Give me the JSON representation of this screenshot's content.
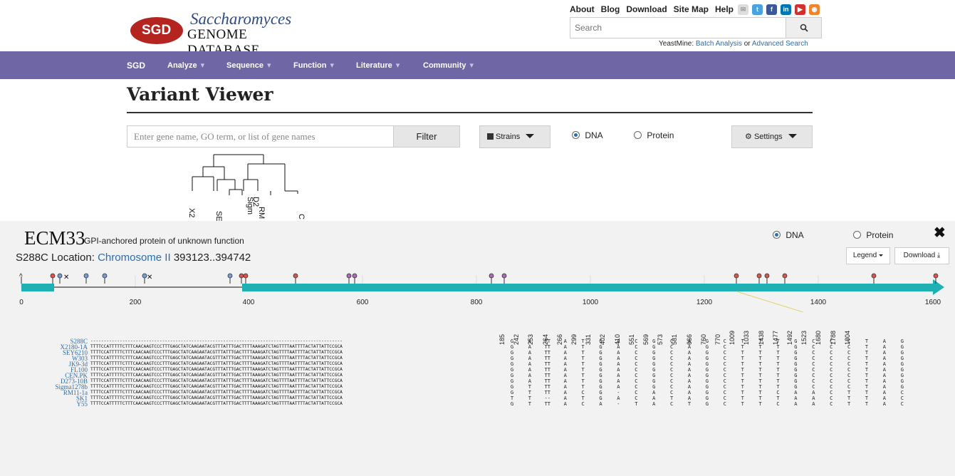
{
  "header": {
    "logo": {
      "badge": "SGD",
      "line1": "Saccharomyces",
      "line2": "GENOME DATABASE"
    },
    "top_links": [
      "About",
      "Blog",
      "Download",
      "Site Map",
      "Help"
    ],
    "social_icons": [
      "mail-icon",
      "twitter-icon",
      "facebook-icon",
      "linkedin-icon",
      "youtube-icon",
      "rss-icon"
    ],
    "search": {
      "placeholder": "Search"
    },
    "yeastmine": {
      "prefix": "YeastMine:",
      "batch": "Batch Analysis",
      "or": "or",
      "advanced": "Advanced Search"
    }
  },
  "nav": {
    "items": [
      "SGD",
      "Analyze",
      "Sequence",
      "Function",
      "Literature",
      "Community"
    ]
  },
  "page": {
    "title": "Variant Viewer"
  },
  "filter": {
    "placeholder": "Enter gene name, GO term, or list of gene names",
    "button": "Filter",
    "strains": "Strains",
    "dna": "DNA",
    "protein": "Protein",
    "settings": "Settings"
  },
  "tree_labels": [
    "X2",
    "SE",
    "Sigm",
    "D2",
    "RM",
    "C"
  ],
  "panel": {
    "gene": "ECM33",
    "description": "GPI-anchored protein of unknown function",
    "location_prefix": "S288C Location:",
    "chromosome": "Chromosome II",
    "coords": "393123..394742",
    "dna": "DNA",
    "protein": "Protein",
    "legend": "Legend",
    "download": "Download",
    "axis_ticks": [
      "0",
      "200",
      "400",
      "600",
      "800",
      "1000",
      "1200",
      "1400",
      "1600"
    ]
  },
  "colors": {
    "nav": "#6f66a5",
    "logo": "#b5251f",
    "link": "#2a6db0",
    "track": "#1fb0b4",
    "pin_red": "#d9534f",
    "pin_blue": "#6fa0d8",
    "pin_purple": "#a66bb0"
  },
  "alignment": {
    "strains": [
      "S288C",
      "X2180-1A",
      "SEY6210",
      "W303",
      "JK9-3d",
      "FL100",
      "CEN.PK",
      "D273-10B",
      "Sigma1278b",
      "RM11-1a",
      "SK1",
      "Y55"
    ],
    "sequence": "TTTTCCATTTTTCTTTCAACAAGTCCCTTTGAGCTATCAAGAATACGTTTATTTGACTTTTAAAGATCTAGTTTTAATTTTACTATTATTCCGCA",
    "positions": [
      "185",
      "242",
      "253",
      "264",
      "266",
      "299",
      "331",
      "402",
      "410",
      "551",
      "569",
      "573",
      "581",
      "666",
      "760",
      "770",
      "1009",
      "1033",
      "1438",
      "1477",
      "1492",
      "1523",
      "1680",
      "1788",
      "1804"
    ],
    "columns": [
      [
        "G",
        "G",
        "G",
        "G",
        "G",
        "G",
        "G",
        "G",
        "G",
        "G",
        "T",
        "G"
      ],
      [
        "A",
        "A",
        "A",
        "A",
        "A",
        "A",
        "A",
        "A",
        "T",
        "T",
        "T",
        "T"
      ],
      [
        "TT",
        "TT",
        "TT",
        "TT",
        "TT",
        "TT",
        "TT",
        "TT",
        "TT",
        "TT",
        "--",
        "TT"
      ],
      [
        "A",
        "A",
        "A",
        "A",
        "A",
        "A",
        "A",
        "A",
        "A",
        "A",
        "A",
        "A"
      ],
      [
        "T",
        "T",
        "T",
        "T",
        "T",
        "T",
        "T",
        "T",
        "T",
        "C",
        "T",
        "C"
      ],
      [
        "G",
        "G",
        "G",
        "G",
        "G",
        "G",
        "G",
        "G",
        "G",
        "G",
        "G",
        "A"
      ],
      [
        "A",
        "A",
        "A",
        "A",
        "A",
        "A",
        "A",
        "A",
        "A",
        "-",
        "A",
        "-"
      ],
      [
        "C",
        "C",
        "C",
        "C",
        "C",
        "C",
        "C",
        "C",
        "C",
        "C",
        "C",
        "T"
      ],
      [
        "G",
        "G",
        "G",
        "G",
        "G",
        "G",
        "G",
        "G",
        "G",
        "A",
        "A",
        "A"
      ],
      [
        "C",
        "C",
        "C",
        "C",
        "C",
        "C",
        "C",
        "C",
        "C",
        "C",
        "T",
        "C"
      ],
      [
        "A",
        "A",
        "A",
        "A",
        "A",
        "A",
        "A",
        "A",
        "A",
        "A",
        "A",
        "T"
      ],
      [
        "G",
        "G",
        "G",
        "G",
        "G",
        "G",
        "G",
        "G",
        "G",
        "G",
        "G",
        "G"
      ],
      [
        "C",
        "C",
        "C",
        "C",
        "C",
        "C",
        "C",
        "C",
        "C",
        "C",
        "C",
        "C"
      ],
      [
        "T",
        "T",
        "T",
        "T",
        "T",
        "T",
        "T",
        "T",
        "T",
        "T",
        "T",
        "T"
      ],
      [
        "T",
        "T",
        "T",
        "T",
        "T",
        "T",
        "T",
        "T",
        "T",
        "T",
        "T",
        "T"
      ],
      [
        "T",
        "T",
        "T",
        "T",
        "T",
        "T",
        "T",
        "T",
        "T",
        "C",
        "T",
        "C"
      ],
      [
        "G",
        "G",
        "G",
        "G",
        "G",
        "G",
        "G",
        "G",
        "G",
        "A",
        "A",
        "A"
      ],
      [
        "C",
        "C",
        "C",
        "C",
        "C",
        "C",
        "C",
        "C",
        "C",
        "A",
        "A",
        "A"
      ],
      [
        "C",
        "C",
        "C",
        "C",
        "C",
        "C",
        "C",
        "C",
        "C",
        "C",
        "C",
        "C"
      ],
      [
        "C",
        "C",
        "C",
        "C",
        "C",
        "C",
        "C",
        "C",
        "C",
        "T",
        "T",
        "T"
      ],
      [
        "T",
        "T",
        "T",
        "T",
        "T",
        "T",
        "T",
        "T",
        "T",
        "T",
        "T",
        "T"
      ],
      [
        "A",
        "A",
        "A",
        "A",
        "A",
        "A",
        "A",
        "A",
        "A",
        "A",
        "A",
        "A"
      ],
      [
        "G",
        "G",
        "G",
        "G",
        "G",
        "G",
        "G",
        "G",
        "G",
        "C",
        "C",
        "C"
      ]
    ]
  }
}
